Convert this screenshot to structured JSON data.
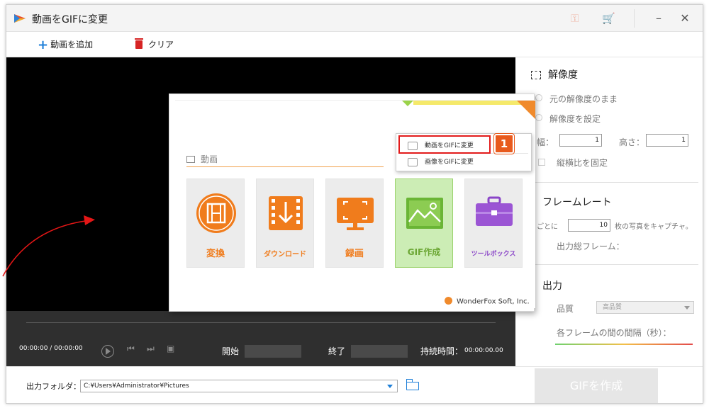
{
  "window": {
    "title": "動画をGIFに変更"
  },
  "toolbar": {
    "add_label": "動画を追加",
    "clear_label": "クリア"
  },
  "player": {
    "time_current": "00:00:00",
    "time_sep": "/",
    "time_total": "00:00:00",
    "start_label": "開始",
    "end_label": "終了",
    "duration_label": "持続時間：",
    "duration_value": "00:00:00.00"
  },
  "panel": {
    "resolution": {
      "heading": "解像度",
      "keep_original": "元の解像度のまま",
      "set_resolution": "解像度を設定",
      "width_label": "幅：",
      "width_value": "1",
      "height_label": "高さ：",
      "height_value": "1",
      "lock_ratio": "縦横比を固定"
    },
    "framerate": {
      "heading": "フレームレート",
      "per_prefix": "ごとに",
      "per_value": "10",
      "per_suffix": "枚の写真をキャプチャ。",
      "total_frames": "出力総フレーム："
    },
    "output": {
      "heading": "出力",
      "quality_label": "品質",
      "quality_value": "高品質",
      "interval_label": "各フレームの間の間隔（秒）："
    }
  },
  "bottom": {
    "output_folder_label": "出力フォルダ：",
    "output_folder_value": "C:¥Users¥Administrator¥Pictures",
    "create_button": "GIFを作成"
  },
  "launcher": {
    "section_title": "動画",
    "tiles": [
      {
        "label": "変換",
        "icon": "film-icon"
      },
      {
        "label": "ダウンロード",
        "icon": "download-icon"
      },
      {
        "label": "録画",
        "icon": "screen-record-icon"
      },
      {
        "label": "GIF作成",
        "icon": "gif-image-icon"
      },
      {
        "label": "ツールボックス",
        "icon": "toolbox-icon"
      }
    ],
    "brand": "WonderFox Soft, Inc.",
    "menu": {
      "item1": "動画をGIFに変更",
      "item2": "画像をGIFに変更"
    },
    "step_badge": "1"
  },
  "colors": {
    "accent_orange": "#f07c1c",
    "highlight_red": "#e21b1b",
    "gif_tile_green": "#ccedb5",
    "toolbox_purple": "#8a45c8",
    "link_blue": "#1e7fd8"
  }
}
